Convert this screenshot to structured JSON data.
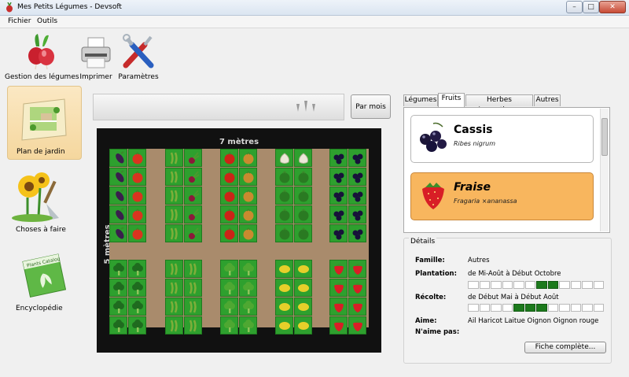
{
  "window": {
    "title": "Mes Petits Légumes - Devsoft",
    "min": "–",
    "max": "□",
    "close": "✕"
  },
  "menu": [
    {
      "label": "Fichier"
    },
    {
      "label": "Outils"
    }
  ],
  "toolbar": [
    {
      "label": "Gestion des légumes",
      "icon": "radish-icon"
    },
    {
      "label": "Imprimer",
      "icon": "printer-icon"
    },
    {
      "label": "Paramètres",
      "icon": "tools-icon"
    }
  ],
  "nav": [
    {
      "label": "Plan de jardin",
      "icon": "garden-plan-icon",
      "active": true
    },
    {
      "label": "Choses à faire",
      "icon": "sunflower-icon",
      "active": false
    },
    {
      "label": "Encyclopédie",
      "icon": "plants-catalog-icon",
      "active": false
    }
  ],
  "plants_catalog_text": "Plants Catalog",
  "timeline_button": "Par mois",
  "garden": {
    "width_label": "7 mètres",
    "height_label": "5 mètres"
  },
  "veggie_colors": {
    "aubergine": "#3a1f4d",
    "tomate": "#d9341f",
    "betterave": "#8b1a3a",
    "poivron": "#cc2417",
    "oignon": "#c98a2f",
    "ail": "#ece8d8",
    "epinard": "#2a7a22",
    "cassis": "#17123a",
    "brocoli": "#1f6b1f",
    "haricot": "#7fae3a",
    "laitue": "#4ea832",
    "citron": "#e6cf2a",
    "fraise": "#d81e26"
  },
  "tabs": [
    {
      "label": "Légumes",
      "active": false
    },
    {
      "label": "Fruits",
      "active": true
    },
    {
      "label": "Herbes Aromatiques",
      "active": false
    },
    {
      "label": "Autres",
      "active": false
    }
  ],
  "fruits": [
    {
      "name": "Cassis",
      "latin": "Ribes nigrum",
      "icon": "blackcurrant-icon",
      "selected": false
    },
    {
      "name": "Fraise",
      "latin": "Fragaria ×ananassa",
      "icon": "strawberry-icon",
      "selected": true
    }
  ],
  "details": {
    "legend": "Détails",
    "famille_label": "Famille:",
    "famille": "Autres",
    "plantation_label": "Plantation:",
    "plantation": "de Mi-Août à Début Octobre",
    "plantation_fill": [
      0,
      0,
      0,
      0,
      0,
      0,
      1,
      1,
      0,
      0,
      0,
      0
    ],
    "recolte_label": "Récolte:",
    "recolte": "de Début Mai à Début Août",
    "recolte_fill": [
      0,
      0,
      0,
      0,
      1,
      1,
      1,
      0,
      0,
      0,
      0,
      0
    ],
    "aime_label": "Aime:",
    "aime": "Ail Haricot Laitue Oignon Oignon rouge",
    "naime_label": "N'aime pas:",
    "naime": "",
    "fiche_button": "Fiche complète..."
  }
}
